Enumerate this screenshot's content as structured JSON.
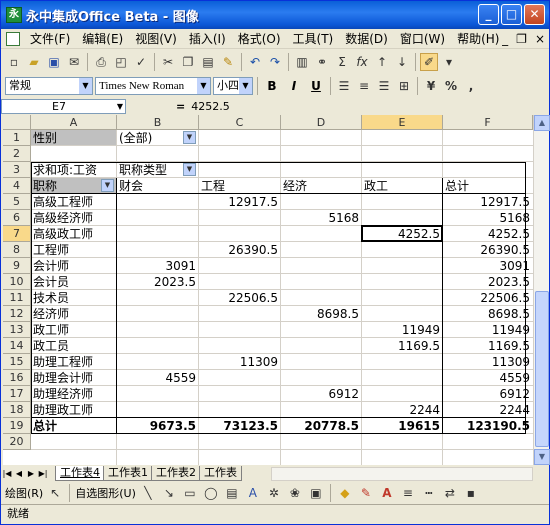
{
  "window": {
    "title": "永中集成Office Beta - 图像",
    "app_icon": "永",
    "min": "_",
    "max": "□",
    "close": "✕"
  },
  "menu": {
    "items": [
      "文件(F)",
      "编辑(E)",
      "视图(V)",
      "插入(I)",
      "格式(O)",
      "工具(T)",
      "数据(D)",
      "窗口(W)",
      "帮助(H)"
    ],
    "doc_min": "_",
    "doc_restore": "❐",
    "doc_close": "×"
  },
  "format_bar": {
    "style": "常规",
    "font": "Times New Roman",
    "size": "小四",
    "bold": "B",
    "italic": "I",
    "underline": "U"
  },
  "formula_bar": {
    "name_box": "E7",
    "equals": "=",
    "value": "4252.5"
  },
  "columns": [
    "A",
    "B",
    "C",
    "D",
    "E",
    "F"
  ],
  "rows": [
    "1",
    "2",
    "3",
    "4",
    "5",
    "6",
    "7",
    "8",
    "9",
    "10",
    "11",
    "12",
    "13",
    "14",
    "15",
    "16",
    "17",
    "18",
    "19",
    "20"
  ],
  "sheet": {
    "r1": {
      "a": "性别",
      "b": "(全部)"
    },
    "r3": {
      "a": "求和项:工资",
      "b": "职称类型"
    },
    "r4": {
      "a": "职称",
      "b": "财会",
      "c": "工程",
      "d": "经济",
      "e": "政工",
      "f": "总计"
    },
    "r5": {
      "a": "高级工程师",
      "c": "12917.5",
      "f": "12917.5"
    },
    "r6": {
      "a": "高级经济师",
      "d": "5168",
      "f": "5168"
    },
    "r7": {
      "a": "高级政工师",
      "e": "4252.5",
      "f": "4252.5"
    },
    "r8": {
      "a": "工程师",
      "c": "26390.5",
      "f": "26390.5"
    },
    "r9": {
      "a": "会计师",
      "b": "3091",
      "f": "3091"
    },
    "r10": {
      "a": "会计员",
      "b": "2023.5",
      "f": "2023.5"
    },
    "r11": {
      "a": "技术员",
      "c": "22506.5",
      "f": "22506.5"
    },
    "r12": {
      "a": "经济师",
      "d": "8698.5",
      "f": "8698.5"
    },
    "r13": {
      "a": "政工师",
      "e": "11949",
      "f": "11949"
    },
    "r14": {
      "a": "政工员",
      "e": "1169.5",
      "f": "1169.5"
    },
    "r15": {
      "a": "助理工程师",
      "c": "11309",
      "f": "11309"
    },
    "r16": {
      "a": "助理会计师",
      "b": "4559",
      "f": "4559"
    },
    "r17": {
      "a": "助理经济师",
      "d": "6912",
      "f": "6912"
    },
    "r18": {
      "a": "助理政工师",
      "e": "2244",
      "f": "2244"
    },
    "r19": {
      "a": "总计",
      "b": "9673.5",
      "c": "73123.5",
      "d": "20778.5",
      "e": "19615",
      "f": "123190.5"
    }
  },
  "tabs": [
    "工作表4",
    "工作表1",
    "工作表2",
    "工作表"
  ],
  "drawbar": {
    "draw": "绘图(R)",
    "autoshape": "自选图形(U)"
  },
  "status": "就绪"
}
